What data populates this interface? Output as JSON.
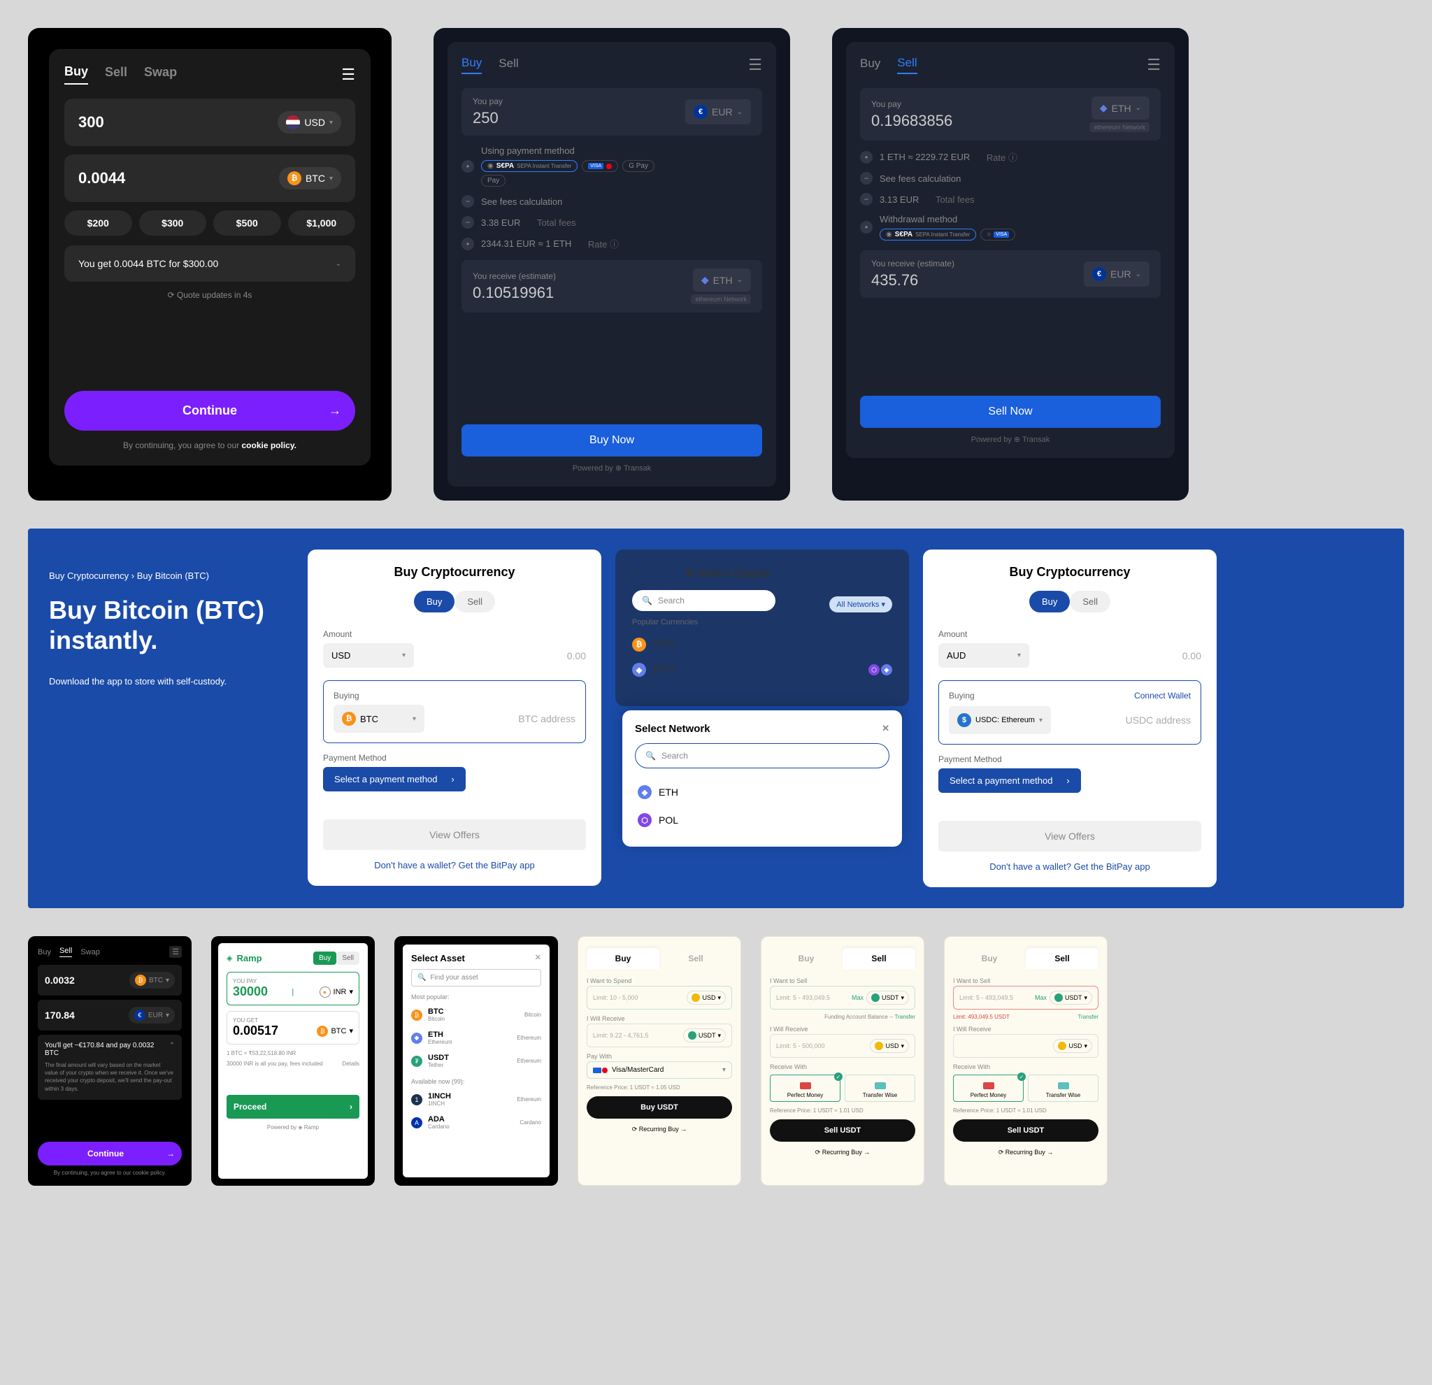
{
  "card1": {
    "tabs": [
      "Buy",
      "Sell",
      "Swap"
    ],
    "amount_in": "300",
    "currency_in": "USD",
    "amount_out": "0.0044",
    "currency_out": "BTC",
    "presets": [
      "$200",
      "$300",
      "$500",
      "$1,000"
    ],
    "summary": "You get 0.0044 BTC for $300.00",
    "update_txt": "⟳ Quote updates in 4s",
    "continue": "Continue",
    "footer_pre": "By continuing, you agree to our ",
    "footer_link": "cookie policy."
  },
  "card2": {
    "tabs": [
      "Buy",
      "Sell"
    ],
    "pay_label": "You pay",
    "pay_value": "250",
    "pay_curr": "EUR",
    "pm_label": "Using payment method",
    "pm_badges": [
      "SEPA Instant Transfer",
      "VISA / MC",
      "G Pay",
      "Apple Pay"
    ],
    "fees_label": "See fees calculation",
    "fees_value": "3.38 EUR",
    "fees_suffix": "Total fees",
    "rate_value": "2344.31 EUR ≈ 1 ETH",
    "rate_suffix": "Rate ⓘ",
    "recv_label": "You receive (estimate)",
    "recv_value": "0.10519961",
    "recv_curr": "ETH",
    "recv_net": "ethereum Network",
    "btn": "Buy Now",
    "powered": "Powered by ⊕ Transak"
  },
  "card3": {
    "tabs": [
      "Buy",
      "Sell"
    ],
    "pay_label": "You pay",
    "pay_value": "0.19683856",
    "pay_curr": "ETH",
    "pay_net": "ethereum Network",
    "rate_value": "1 ETH ≈ 2229.72 EUR",
    "rate_suffix": "Rate ⓘ",
    "fees_label": "See fees calculation",
    "fees_value": "3.13 EUR",
    "fees_suffix": "Total fees",
    "wm_label": "Withdrawal method",
    "wm_badges": [
      "SEPA Instant Transfer",
      "VISA"
    ],
    "recv_label": "You receive (estimate)",
    "recv_value": "435.76",
    "recv_curr": "EUR",
    "btn": "Sell Now",
    "powered": "Powered by ⊕ Transak"
  },
  "bp_hero": {
    "crumb": "Buy Cryptocurrency  ›  Buy Bitcoin (BTC)",
    "title": "Buy Bitcoin (BTC) instantly.",
    "sub": "Download the app to store with self-custody."
  },
  "bp1": {
    "title": "Buy Cryptocurrency",
    "toggle": [
      "Buy",
      "Sell"
    ],
    "amount_label": "Amount",
    "amount_curr": "USD",
    "amount_placeholder": "0.00",
    "buying_label": "Buying",
    "buying_coin": "BTC",
    "addr_placeholder": "BTC address",
    "pm_label": "Payment Method",
    "pm_btn": "Select a payment method",
    "offers": "View Offers",
    "wallet_link": "Don't have a wallet? Get the BitPay app"
  },
  "bp_modal": {
    "back": "←",
    "title": "Select Crypto",
    "search_placeholder": "Search",
    "all_networks": "All Networks ▾",
    "popular_label": "Popular Currencies",
    "popular": [
      "BTC",
      "ETH"
    ],
    "popup_title": "Select Network",
    "popup_search": "Search",
    "networks": [
      "ETH",
      "POL"
    ]
  },
  "bp2": {
    "title": "Buy Cryptocurrency",
    "toggle": [
      "Buy",
      "Sell"
    ],
    "amount_label": "Amount",
    "amount_curr": "AUD",
    "amount_placeholder": "0.00",
    "buying_label": "Buying",
    "connect": "Connect Wallet",
    "coin": "USDC: Ethereum",
    "addr_placeholder": "USDC address",
    "pm_label": "Payment Method",
    "pm_btn": "Select a payment method",
    "offers": "View Offers",
    "wallet_link": "Don't have a wallet? Get the BitPay app"
  },
  "sc1": {
    "tabs": [
      "Buy",
      "Sell",
      "Swap"
    ],
    "v1": "0.0032",
    "c1": "BTC",
    "v2": "170.84",
    "c2": "EUR",
    "info_head": "You'll get ~€170.84 and pay 0.0032 BTC",
    "info_body": "The final amount will vary based on the market value of your crypto when we receive it. Once we've received your crypto deposit, we'll send the pay-out within 3 days.",
    "btn": "Continue",
    "foot": "By continuing, you agree to our cookie policy."
  },
  "sc2": {
    "logo": "Ramp",
    "toggle": [
      "Buy",
      "Sell"
    ],
    "pay_lbl": "YOU PAY",
    "pay_val": "30000",
    "pay_curr": "INR",
    "get_lbl": "YOU GET",
    "get_val": "0.00517",
    "get_curr": "BTC",
    "rate": "1 BTC ≈ ₹53,22,518.80 INR",
    "fee_pre": "30000 INR is all you pay, fees included",
    "details": "Details",
    "btn": "Proceed",
    "powered": "Powered by ◈ Ramp"
  },
  "sc3": {
    "title": "Select Asset",
    "search": "Find your asset",
    "popular_lbl": "Most popular:",
    "popular": [
      {
        "sym": "BTC",
        "name": "Bitcoin",
        "net": "Bitcoin",
        "color": "#f7931a"
      },
      {
        "sym": "ETH",
        "name": "Ethereum",
        "net": "Ethereum",
        "color": "#627eea"
      },
      {
        "sym": "USDT",
        "name": "Tether",
        "net": "Ethereum",
        "color": "#26a17b"
      }
    ],
    "avail_lbl": "Available now (99):",
    "avail": [
      {
        "sym": "1INCH",
        "name": "1INCH",
        "net": "Ethereum",
        "color": "#1b314f"
      },
      {
        "sym": "ADA",
        "name": "Cardano",
        "net": "Cardano",
        "color": "#0033ad"
      }
    ]
  },
  "bs1": {
    "tabs": [
      "Buy",
      "Sell"
    ],
    "active": 0,
    "spend_lbl": "I Want to Spend",
    "spend_limit": "Limit: 10 - 5,000",
    "spend_curr": "USD",
    "recv_lbl": "I Will Receive",
    "recv_limit": "Limit: 9.22 - 4,761.5",
    "recv_curr": "USDT",
    "pay_lbl": "Pay With",
    "pay_method": "Visa/MasterCard",
    "ref": "Reference Price: 1 USDT ≈ 1.05 USD",
    "btn": "Buy USDT",
    "recur": "⟳ Recurring Buy →"
  },
  "bs2": {
    "tabs": [
      "Buy",
      "Sell"
    ],
    "active": 1,
    "sell_lbl": "I Want to Sell",
    "sell_limit": "Limit: 5 - 493,049.5",
    "sell_curr": "USDT",
    "max": "Max",
    "bal_lbl": "Funding Account Balance",
    "transfer": "Transfer",
    "recv_lbl": "I Will Receive",
    "recv_limit": "Limit: 5 - 500,000",
    "recv_curr": "USD",
    "rw_lbl": "Receive With",
    "rw": [
      "Perfect Money",
      "Transfer Wise"
    ],
    "ref": "Reference Price: 1 USDT ≈ 1.01 USD",
    "btn": "Sell USDT",
    "recur": "⟳ Recurring Buy →"
  },
  "bs3": {
    "tabs": [
      "Buy",
      "Sell"
    ],
    "active": 1,
    "sell_lbl": "I Want to Sell",
    "sell_limit": "Limit: 5 - 493,049.5",
    "sell_curr": "USDT",
    "max": "Max",
    "err": "Limit: 493,049.5 USDT",
    "transfer": "Transfer",
    "recv_lbl": "I Will Receive",
    "recv_curr": "USD",
    "rw_lbl": "Receive With",
    "rw": [
      "Perfect Money",
      "Transfer Wise"
    ],
    "ref": "Reference Price: 1 USDT ≈ 1.01 USD",
    "btn": "Sell USDT",
    "recur": "⟳ Recurring Buy →"
  }
}
